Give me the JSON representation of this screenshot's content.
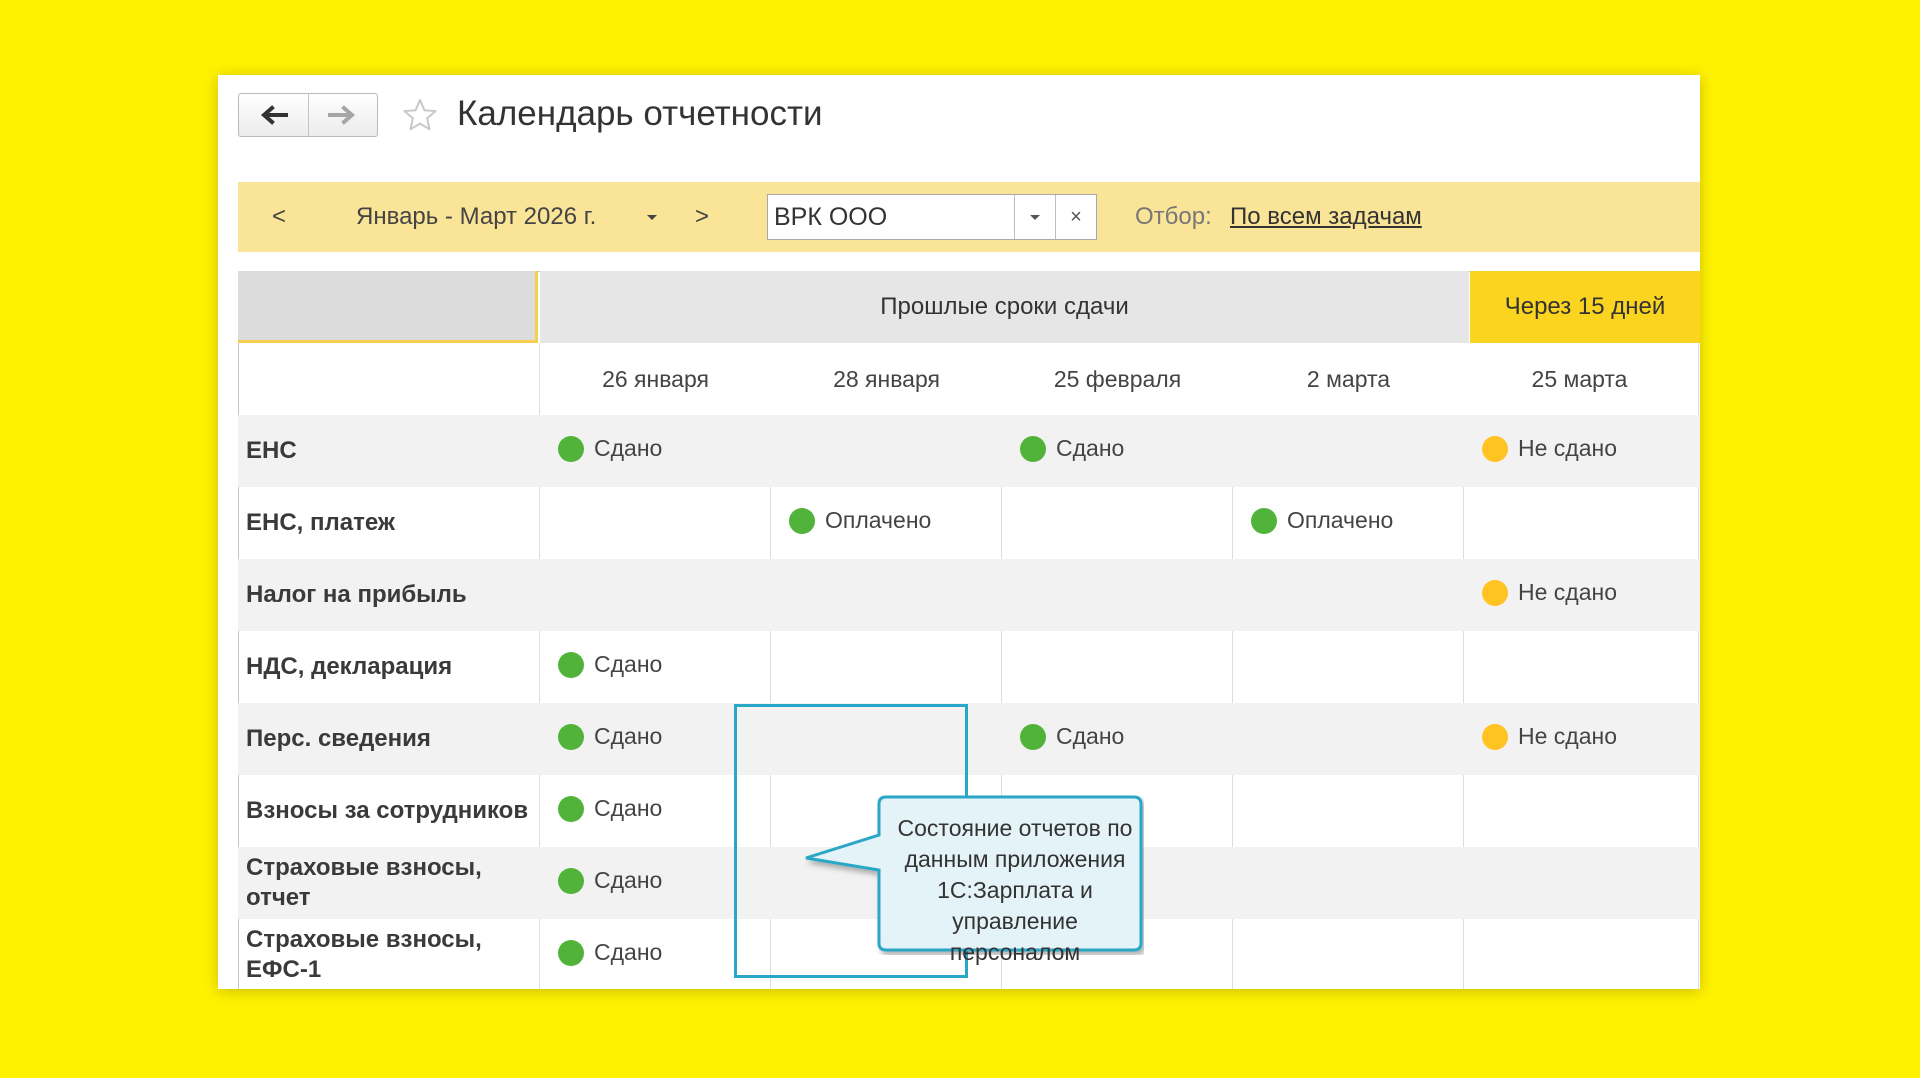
{
  "window": {
    "title": "Календарь отчетности",
    "icons": {
      "back": "arrow-left-icon",
      "forward": "arrow-right-icon",
      "favorite": "star-icon"
    }
  },
  "toolbar": {
    "prev_label": "<",
    "period_label": "Январь - Март 2026 г.",
    "next_label": ">",
    "organization_value": "ВРК ООО",
    "clear_label": "×",
    "filter_label": "Отбор:",
    "filter_value": "По всем задачам"
  },
  "grid": {
    "groups": {
      "past": "Прошлые сроки сдачи",
      "soon": "Через 15 дней"
    },
    "dates": [
      "26 января",
      "28 января",
      "25 февраля",
      "2 марта",
      "25 марта"
    ],
    "rows": [
      {
        "label": "ЕНС",
        "cells": [
          {
            "text": "Сдано",
            "color": "green"
          },
          null,
          {
            "text": "Сдано",
            "color": "green"
          },
          null,
          {
            "text": "Не сдано",
            "color": "yellow"
          }
        ]
      },
      {
        "label": "ЕНС, платеж",
        "cells": [
          null,
          {
            "text": "Оплачено",
            "color": "green"
          },
          null,
          {
            "text": "Оплачено",
            "color": "green"
          },
          null
        ]
      },
      {
        "label": "Налог на прибыль",
        "cells": [
          null,
          null,
          null,
          null,
          {
            "text": "Не сдано",
            "color": "yellow"
          }
        ]
      },
      {
        "label": "НДС, декларация",
        "cells": [
          {
            "text": "Сдано",
            "color": "green"
          },
          null,
          null,
          null,
          null
        ]
      },
      {
        "label": "Перс. сведения",
        "cells": [
          {
            "text": "Сдано",
            "color": "green"
          },
          null,
          {
            "text": "Сдано",
            "color": "green"
          },
          null,
          {
            "text": "Не сдано",
            "color": "yellow"
          }
        ]
      },
      {
        "label": "Взносы за сотрудников",
        "cells": [
          {
            "text": "Сдано",
            "color": "green"
          },
          null,
          null,
          null,
          null
        ]
      },
      {
        "label": "Страховые взносы, отчет",
        "cells": [
          {
            "text": "Сдано",
            "color": "green"
          },
          null,
          null,
          null,
          null
        ]
      },
      {
        "label": "Страховые взносы, ЕФС-1",
        "cells": [
          {
            "text": "Сдано",
            "color": "green"
          },
          null,
          null,
          null,
          null
        ]
      }
    ]
  },
  "callout": {
    "text": "Состояние отчетов по данным приложения 1С:Зарплата и управление персоналом"
  },
  "colors": {
    "background": "#fff200",
    "status_green": "#52b33a",
    "status_yellow": "#ffc322",
    "soon_header": "#fbd420",
    "callout_border": "#2aa6c6",
    "callout_fill": "#e4f3f8"
  }
}
